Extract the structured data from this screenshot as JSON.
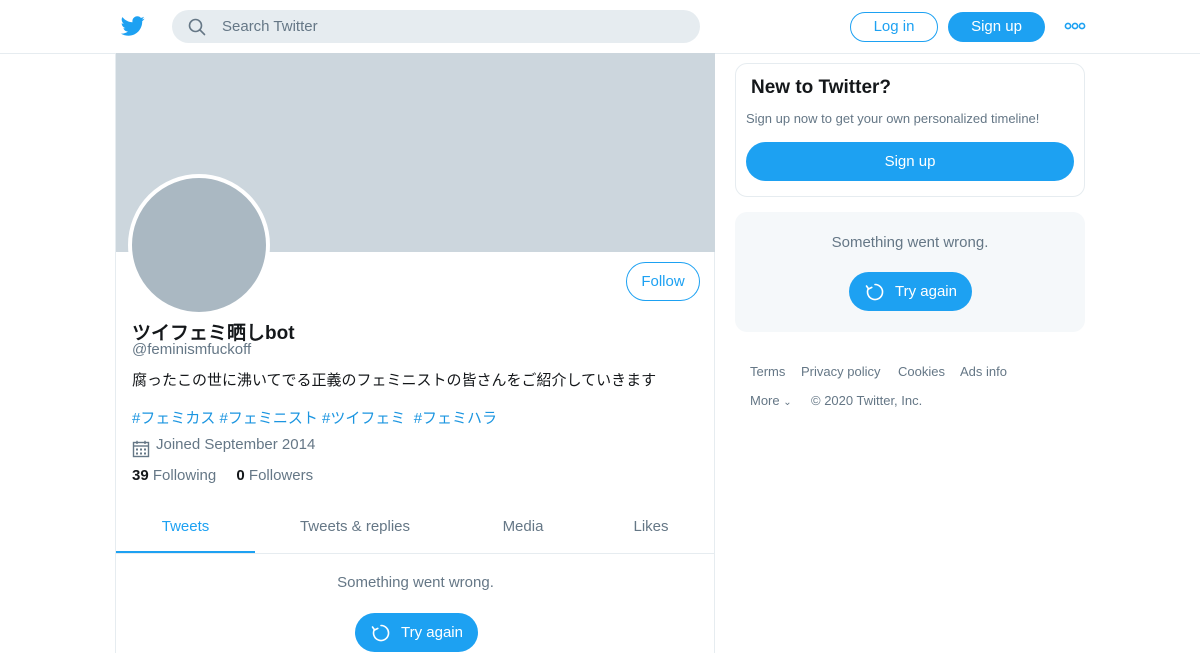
{
  "colors": {
    "accent": "#1da1f2",
    "link": "#1b95e0",
    "muted": "#657786",
    "banner": "#ccd6dd",
    "avatar": "#aab8c2"
  },
  "header": {
    "logo_icon": "twitter-bird-icon",
    "search_placeholder": "Search Twitter",
    "login_label": "Log in",
    "signup_label": "Sign up",
    "more_icon": "more-dots-icon"
  },
  "profile": {
    "display_name": "ツイフェミ晒しbot",
    "handle": "@feminismfuckoff",
    "bio": "腐ったこの世に沸いてでる正義のフェミニストの皆さんをご紹介していきます",
    "hashtags": [
      "#フェミカス",
      "#フェミニスト",
      "#ツイフェミ",
      "#フェミハラ"
    ],
    "joined": "Joined September 2014",
    "following_count": "39",
    "following_label": "Following",
    "followers_count": "0",
    "followers_label": "Followers",
    "follow_label": "Follow"
  },
  "tabs": [
    {
      "label": "Tweets",
      "active": true
    },
    {
      "label": "Tweets & replies",
      "active": false
    },
    {
      "label": "Media",
      "active": false
    },
    {
      "label": "Likes",
      "active": false
    }
  ],
  "timeline": {
    "error_text": "Something went wrong.",
    "retry_label": "Try again"
  },
  "sidebar": {
    "new_title": "New to Twitter?",
    "new_subtitle": "Sign up now to get your own personalized timeline!",
    "signup_label": "Sign up",
    "error_text": "Something went wrong.",
    "retry_label": "Try again"
  },
  "footer": {
    "links": [
      "Terms",
      "Privacy policy",
      "Cookies",
      "Ads info"
    ],
    "more_label": "More",
    "copyright": "© 2020 Twitter, Inc."
  }
}
